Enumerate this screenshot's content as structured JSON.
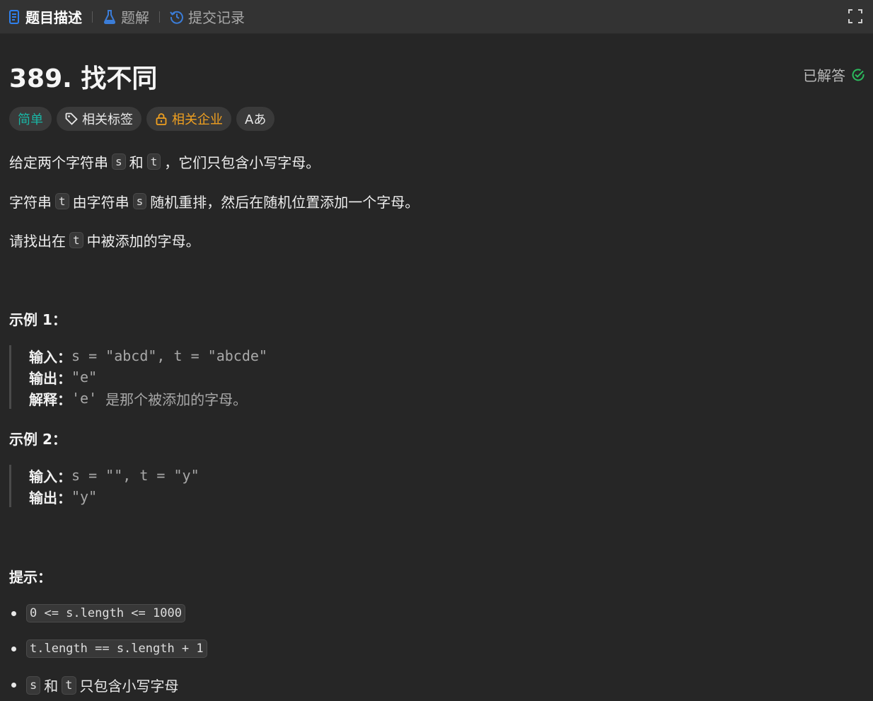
{
  "tabs": [
    {
      "label": "题目描述",
      "icon": "description-icon",
      "active": true
    },
    {
      "label": "题解",
      "icon": "flask-icon",
      "active": false
    },
    {
      "label": "提交记录",
      "icon": "history-icon",
      "active": false
    }
  ],
  "problem": {
    "title": "389. 找不同",
    "status": "已解答",
    "tags": {
      "difficulty": "简单",
      "related_tags": "相关标签",
      "related_companies": "相关企业",
      "language_toggle": "Aあ"
    }
  },
  "description": {
    "p1": {
      "a": "给定两个字符串",
      "code1": "s",
      "b": "和",
      "code2": "t",
      "c": "，它们只包含小写字母。"
    },
    "p2": {
      "a": "字符串",
      "code1": "t",
      "b": "由字符串",
      "code2": "s",
      "c": "随机重排，然后在随机位置添加一个字母。"
    },
    "p3": {
      "a": "请找出在",
      "code1": "t",
      "b": "中被添加的字母。"
    }
  },
  "examples": [
    {
      "heading": "示例 1：",
      "input_label": "输入：",
      "input": "s = \"abcd\", t = \"abcde\"",
      "output_label": "输出：",
      "output": "\"e\"",
      "explain_label": "解释：",
      "explain_code": "'e'",
      "explain_text": "是那个被添加的字母。"
    },
    {
      "heading": "示例 2：",
      "input_label": "输入：",
      "input": "s = \"\", t = \"y\"",
      "output_label": "输出：",
      "output": "\"y\""
    }
  ],
  "constraints": {
    "heading": "提示：",
    "items": [
      "0 <= s.length <= 1000",
      "t.length == s.length + 1"
    ],
    "item3": {
      "code1": "s",
      "a": "和",
      "code2": "t",
      "b": "只包含小写字母"
    }
  },
  "colors": {
    "easy": "#1ab5a4",
    "company": "#f0a020",
    "solved_check": "#2cbb5d",
    "active_tab_icon": "#2f80ed",
    "flask_icon": "#3b7dd8"
  }
}
